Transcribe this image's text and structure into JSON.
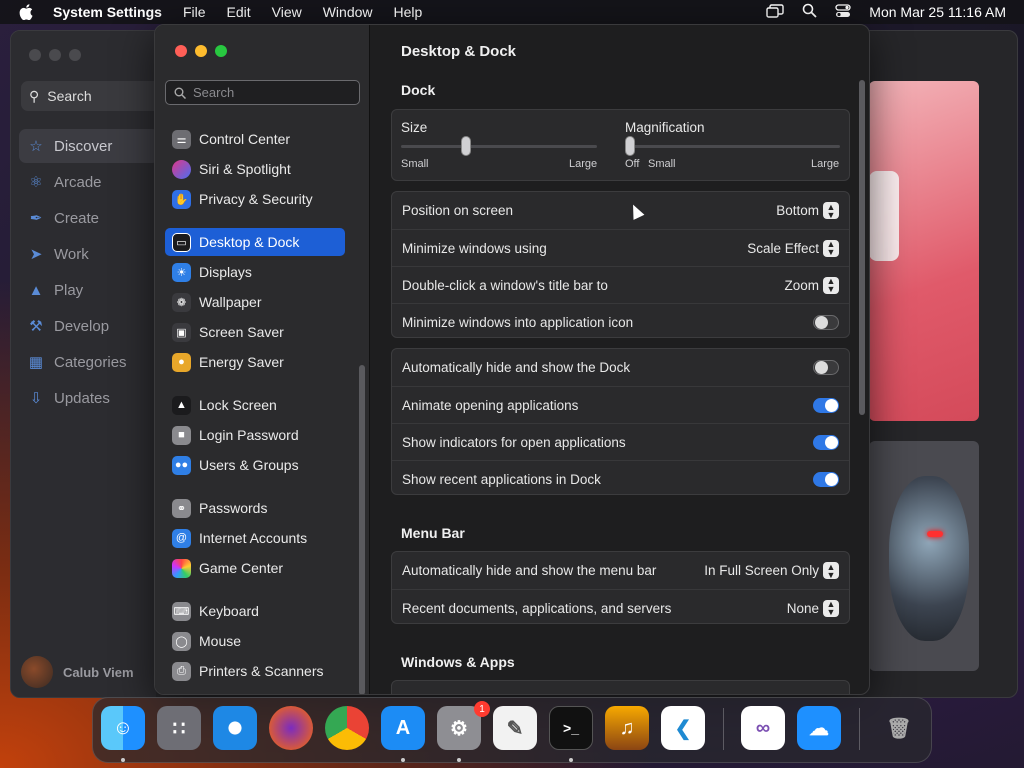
{
  "menubar": {
    "app_name": "System Settings",
    "menus": [
      "File",
      "Edit",
      "View",
      "Window",
      "Help"
    ],
    "clock": "Mon Mar 25  11:16 AM"
  },
  "appstore": {
    "search": "Search",
    "items": [
      {
        "label": "Discover",
        "icon": "star-icon"
      },
      {
        "label": "Arcade",
        "icon": "joystick-icon"
      },
      {
        "label": "Create",
        "icon": "brush-icon"
      },
      {
        "label": "Work",
        "icon": "paperplane-icon"
      },
      {
        "label": "Play",
        "icon": "rocket-icon"
      },
      {
        "label": "Develop",
        "icon": "hammer-icon"
      },
      {
        "label": "Categories",
        "icon": "grid-icon"
      },
      {
        "label": "Updates",
        "icon": "download-icon"
      }
    ],
    "user": "Calub Viem"
  },
  "settings": {
    "search_placeholder": "Search",
    "sidebar": [
      {
        "label": "Control Center",
        "color": "#6d6d72"
      },
      {
        "label": "Siri & Spotlight",
        "color": "#b02fd6"
      },
      {
        "label": "Privacy & Security",
        "color": "#2f6fe6"
      },
      {
        "label": "Desktop & Dock",
        "color": "#1b1b1d",
        "active": true
      },
      {
        "label": "Displays",
        "color": "#2f7fe6"
      },
      {
        "label": "Wallpaper",
        "color": "#3a3a3e"
      },
      {
        "label": "Screen Saver",
        "color": "#3a3a3e"
      },
      {
        "label": "Energy Saver",
        "color": "#e8a72a"
      },
      {
        "label": "Lock Screen",
        "color": "#1b1b1d"
      },
      {
        "label": "Login Password",
        "color": "#8a8a8e"
      },
      {
        "label": "Users & Groups",
        "color": "#2f7fe6"
      },
      {
        "label": "Passwords",
        "color": "#8a8a8e"
      },
      {
        "label": "Internet Accounts",
        "color": "#2f7fe6"
      },
      {
        "label": "Game Center",
        "color": "#ffffff"
      },
      {
        "label": "Keyboard",
        "color": "#8a8a8e"
      },
      {
        "label": "Mouse",
        "color": "#8a8a8e"
      },
      {
        "label": "Printers & Scanners",
        "color": "#8a8a8e"
      }
    ],
    "pane_title": "Desktop & Dock",
    "dock_section": "Dock",
    "size": {
      "label": "Size",
      "min": "Small",
      "max": "Large",
      "value": 0.33
    },
    "magnification": {
      "label": "Magnification",
      "off": "Off",
      "min": "Small",
      "max": "Large",
      "value": 0.0
    },
    "rows1": [
      {
        "label": "Position on screen",
        "value": "Bottom"
      },
      {
        "label": "Minimize windows using",
        "value": "Scale Effect"
      },
      {
        "label": "Double-click a window's title bar to",
        "value": "Zoom"
      },
      {
        "label": "Minimize windows into application icon",
        "toggle": false
      }
    ],
    "rows2": [
      {
        "label": "Automatically hide and show the Dock",
        "toggle": false
      },
      {
        "label": "Animate opening applications",
        "toggle": true
      },
      {
        "label": "Show indicators for open applications",
        "toggle": true
      },
      {
        "label": "Show recent applications in Dock",
        "toggle": true
      }
    ],
    "menubar_section": "Menu Bar",
    "rows3": [
      {
        "label": "Automatically hide and show the menu bar",
        "value": "In Full Screen Only"
      },
      {
        "label": "Recent documents, applications, and servers",
        "value": "None"
      }
    ],
    "windows_section": "Windows & Apps"
  },
  "dock": {
    "badge": "1"
  }
}
